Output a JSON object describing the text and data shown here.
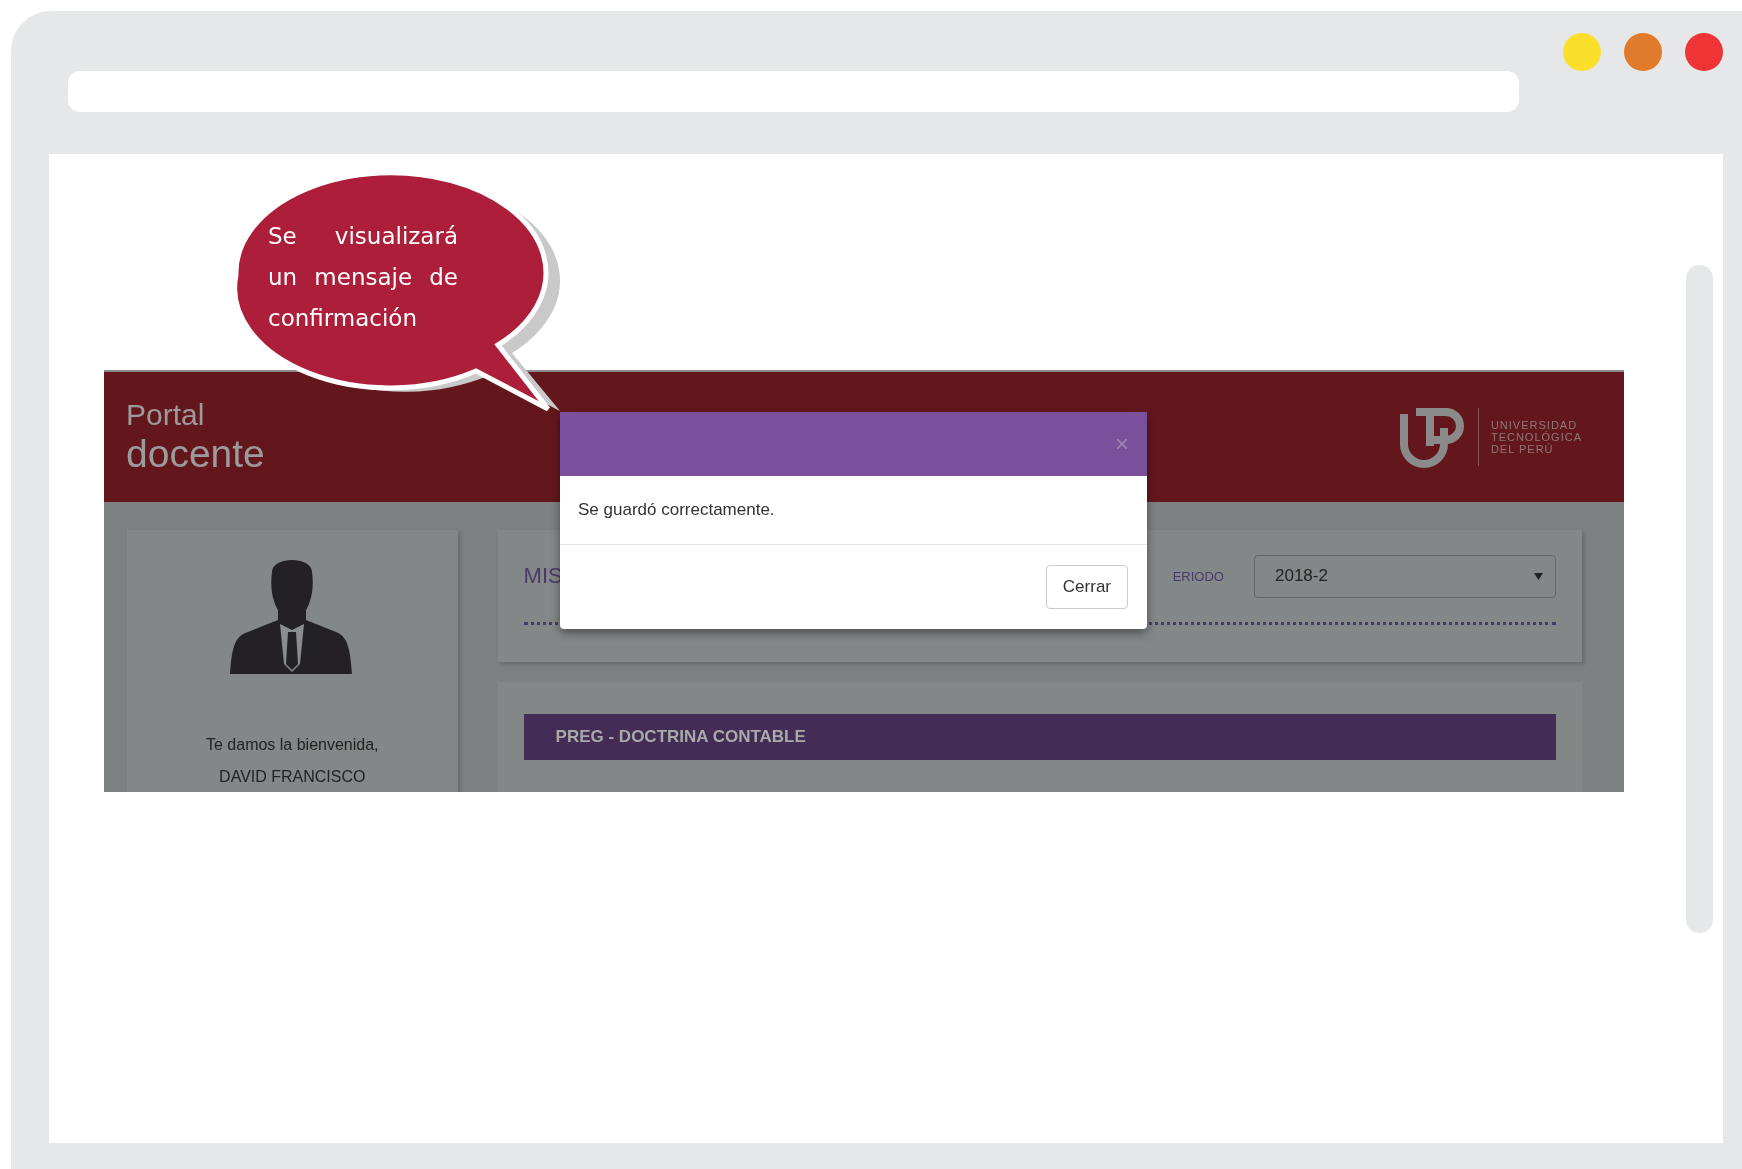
{
  "browser": {
    "window_controls": [
      {
        "color": "#fbe02b"
      },
      {
        "color": "#e07b2b"
      },
      {
        "color": "#ef3435"
      }
    ]
  },
  "callout": {
    "text": "Se visualizará un mensaje de confirmación"
  },
  "portal": {
    "title_line_1": "Portal",
    "title_line_2": "docente",
    "logo_text": [
      "UNIVERSIDAD",
      "TECNOLÓGICA",
      "DEL PERÚ"
    ]
  },
  "profile": {
    "greeting": "Te damos la bienvenida,",
    "name": "DAVID FRANCISCO"
  },
  "courses_panel": {
    "heading": "MIS",
    "period_label": "ERIODO",
    "period": "2018-2",
    "course_title": "PREG - DOCTRINA CONTABLE"
  },
  "modal": {
    "close": "×",
    "message": "Se guardó correctamente.",
    "button": "Cerrar"
  }
}
